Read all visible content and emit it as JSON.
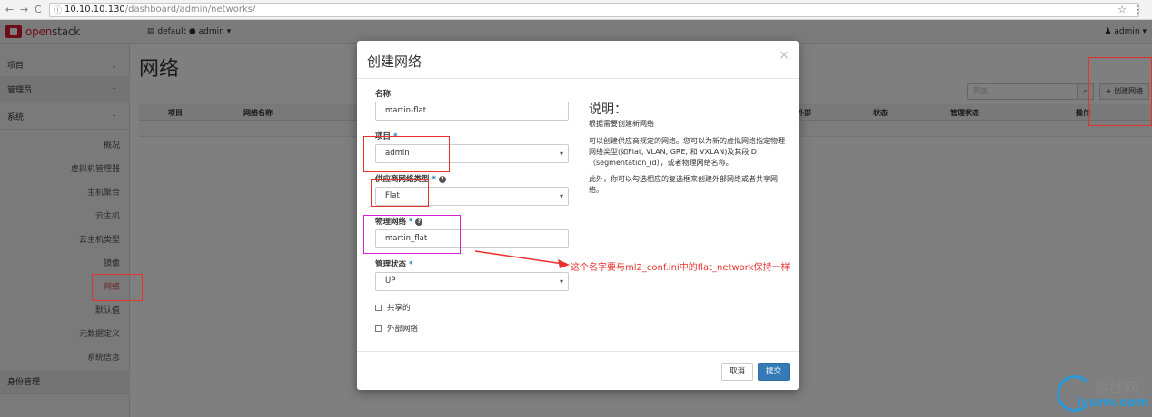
{
  "browser": {
    "back": "←",
    "forward": "→",
    "reload": "C",
    "url_host": "10.10.10.130",
    "url_path": "/dashboard/admin/networks/",
    "star": "☆",
    "menu": "⋮"
  },
  "topnav": {
    "logo_text_prefix": "open",
    "logo_text_suffix": "stack",
    "project_selector": "▤ default ● admin ▾",
    "user_menu": "♟ admin ▾"
  },
  "sidebar": {
    "sections": [
      {
        "label": "项目",
        "chevron": "⌄"
      },
      {
        "label": "管理员",
        "chevron": "⌃"
      },
      {
        "label": "系统",
        "chevron": "⌃"
      },
      {
        "label": "身份管理",
        "chevron": "⌄"
      }
    ],
    "items": [
      "概况",
      "虚拟机管理器",
      "主机聚合",
      "云主机",
      "云主机类型",
      "镜像",
      "网络",
      "默认值",
      "元数据定义",
      "系统信息"
    ],
    "active_item": "网络"
  },
  "main": {
    "page_title": "网络",
    "filter_placeholder": "筛选",
    "filter_icon": "🔍",
    "create_button": "+ 创建网络",
    "columns": [
      "项目",
      "网络名称",
      "外部",
      "状态",
      "管理状态",
      "操作"
    ]
  },
  "modal": {
    "title": "创建网络",
    "close": "×",
    "fields": {
      "name_label": "名称",
      "name_value": "martin-flat",
      "project_label": "项目",
      "project_value": "admin",
      "provider_type_label": "供应商网络类型",
      "provider_type_value": "Flat",
      "physical_network_label": "物理网络",
      "physical_network_value": "martin_flat",
      "admin_state_label": "管理状态",
      "admin_state_value": "UP",
      "shared_label": "共享的",
      "external_label": "外部网络",
      "required_mark": "*",
      "help_mark": "?"
    },
    "description": {
      "title": "说明：",
      "p1": "根据需要创建新网络",
      "p2": "可以创建供应商规定的网络。您可以为新的虚拟网络指定物理网络类型(如Flat, VLAN, GRE, 和 VXLAN)及其段ID（segmentation_id），或者物理网络名称。",
      "p3": "此外，你可以勾选相应的复选框来创建外部网络或者共享网络。"
    },
    "cancel_button": "取消",
    "submit_button": "提交"
  },
  "annotation": {
    "note": "这个名字要与ml2_conf.ini中的flat_network保持一样"
  },
  "watermark": {
    "cn": "运维网",
    "url": "iyunv.com"
  },
  "colors": {
    "accent": "#337ab7",
    "brand": "#da1a32",
    "annotation_red": "#e8312d",
    "annotation_magenta": "#d61fd6"
  }
}
